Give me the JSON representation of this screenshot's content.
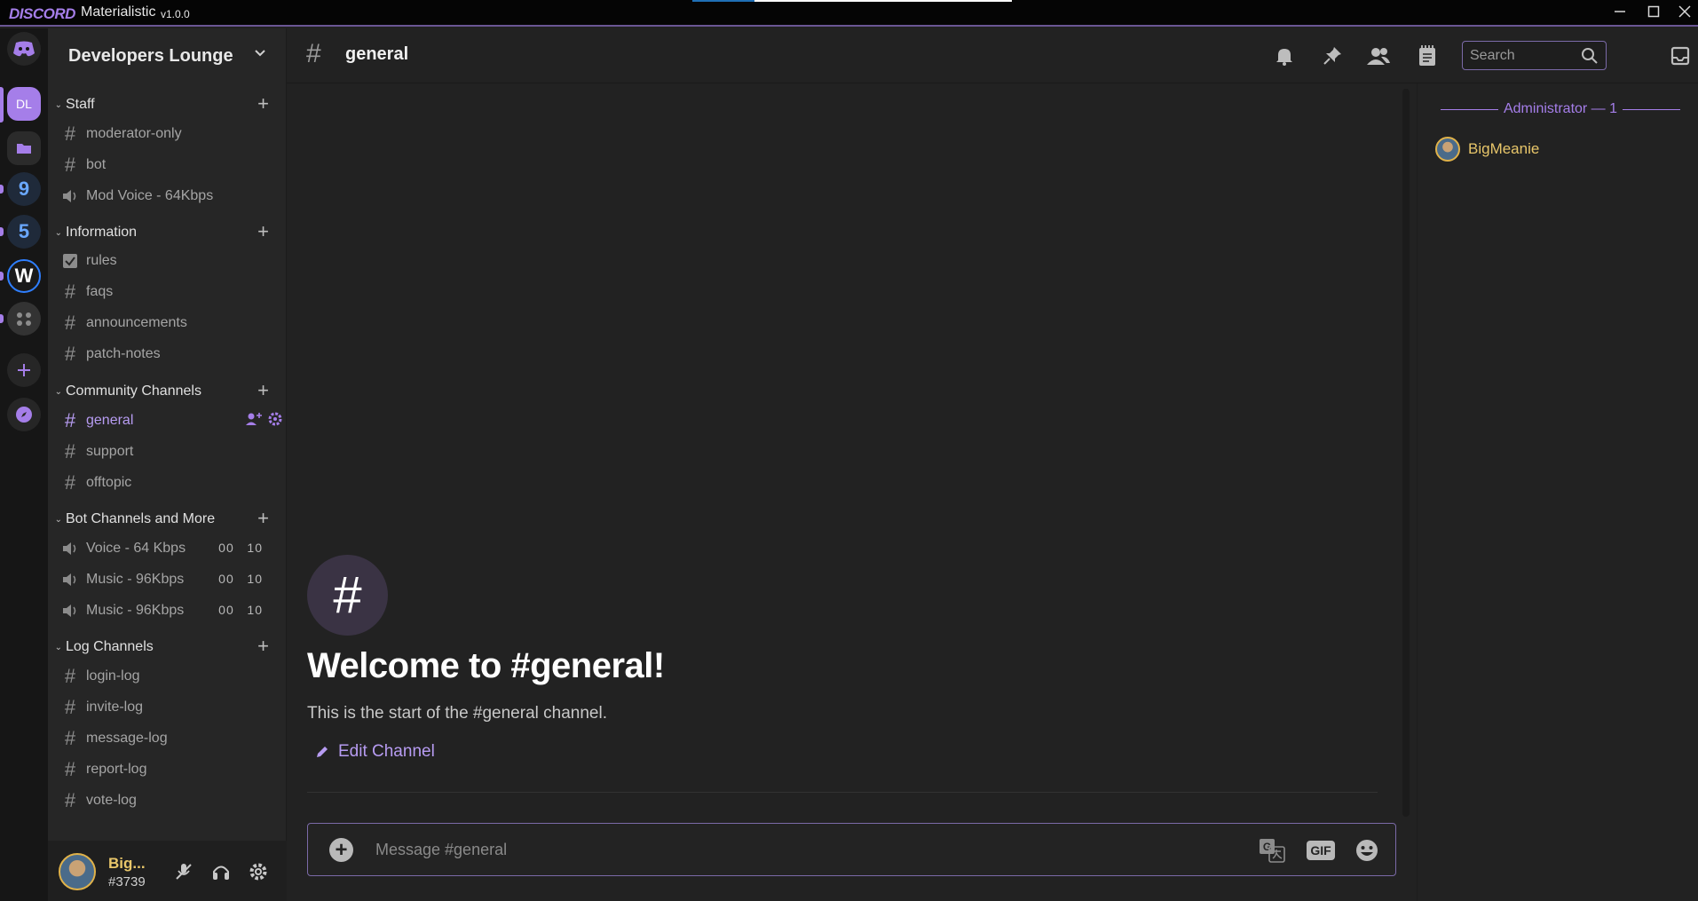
{
  "titlebar": {
    "brand": "DISCORD",
    "app_name": "Materialistic",
    "version": "v1.0.0"
  },
  "rail": {
    "servers": [
      {
        "label": "DL",
        "name": "Developers Lounge",
        "selected": true
      },
      {
        "label": "",
        "name": "folder"
      },
      {
        "label": "9",
        "name": "server-9"
      },
      {
        "label": "5",
        "name": "server-5"
      },
      {
        "label": "W",
        "name": "server-w"
      },
      {
        "label": "",
        "name": "server-misc"
      }
    ]
  },
  "server": {
    "name": "Developers Lounge"
  },
  "categories": [
    {
      "name": "Staff",
      "channels": [
        {
          "name": "moderator-only",
          "type": "text-locked"
        },
        {
          "name": "bot",
          "type": "text-locked"
        },
        {
          "name": "Mod Voice - 64Kbps",
          "type": "voice"
        }
      ]
    },
    {
      "name": "Information",
      "channels": [
        {
          "name": "rules",
          "type": "rules"
        },
        {
          "name": "faqs",
          "type": "text"
        },
        {
          "name": "announcements",
          "type": "text"
        },
        {
          "name": "patch-notes",
          "type": "text"
        }
      ]
    },
    {
      "name": "Community Channels",
      "channels": [
        {
          "name": "general",
          "type": "text",
          "active": true
        },
        {
          "name": "support",
          "type": "text"
        },
        {
          "name": "offtopic",
          "type": "text"
        }
      ]
    },
    {
      "name": "Bot Channels and More",
      "channels": [
        {
          "name": "Voice - 64 Kbps",
          "type": "voice",
          "count_a": "00",
          "count_b": "10"
        },
        {
          "name": "Music - 96Kbps",
          "type": "voice",
          "count_a": "00",
          "count_b": "10"
        },
        {
          "name": "Music - 96Kbps",
          "type": "voice",
          "count_a": "00",
          "count_b": "10"
        }
      ]
    },
    {
      "name": "Log Channels",
      "channels": [
        {
          "name": "login-log",
          "type": "text-locked"
        },
        {
          "name": "invite-log",
          "type": "text-locked"
        },
        {
          "name": "message-log",
          "type": "text-locked"
        },
        {
          "name": "report-log",
          "type": "text-locked"
        },
        {
          "name": "vote-log",
          "type": "text-locked"
        }
      ]
    }
  ],
  "user": {
    "name": "Big...",
    "tag": "#3739"
  },
  "header": {
    "channel": "general",
    "search_placeholder": "Search"
  },
  "welcome": {
    "title": "Welcome to #general!",
    "subtitle": "This is the start of the #general channel.",
    "edit_label": "Edit Channel"
  },
  "composer": {
    "placeholder": "Message #general",
    "gif_label": "GIF"
  },
  "members": {
    "role_heading": "Administrator — 1",
    "list": [
      {
        "name": "BigMeanie"
      }
    ]
  },
  "colors": {
    "accent": "#a57ee9",
    "background": "#222222",
    "sidebar": "#262626",
    "username": "#e8c66a"
  }
}
